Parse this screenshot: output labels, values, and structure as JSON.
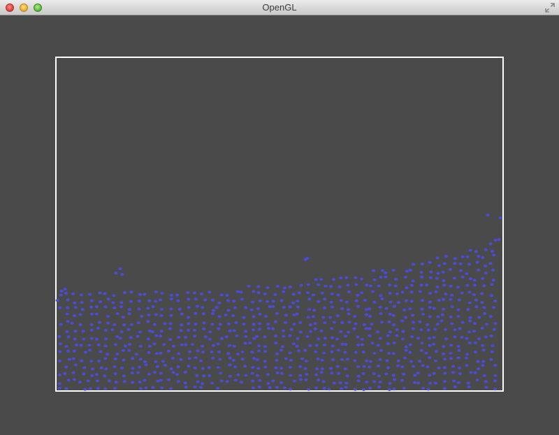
{
  "window": {
    "title": "OpenGL",
    "buttons": [
      "close",
      "minimize",
      "zoom"
    ],
    "fullscreen_icon": "fullscreen-arrows-icon"
  },
  "simulation": {
    "container_outline_color": "#ffffff",
    "particle_color": "#4b4bdb",
    "background_color": "#4a4a4a"
  }
}
